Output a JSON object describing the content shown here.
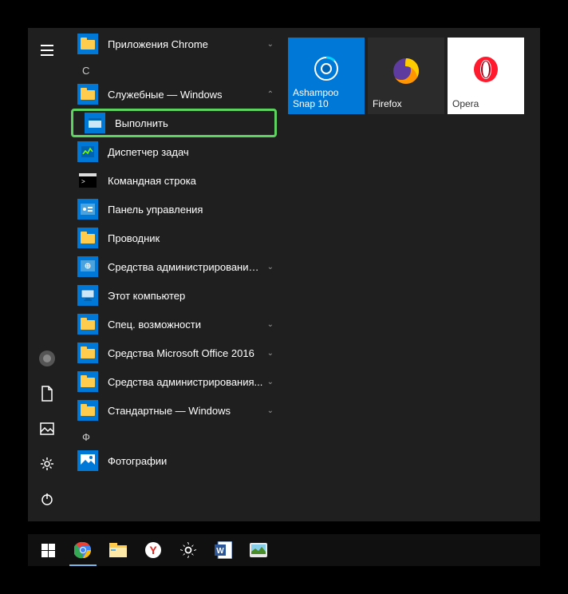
{
  "letters": {
    "c": "С",
    "f": "Ф"
  },
  "apps": {
    "chrome_apps": "Приложения Chrome",
    "system_windows": "Служебные — Windows",
    "run": "Выполнить",
    "task_manager": "Диспетчер задач",
    "cmd": "Командная строка",
    "control_panel": "Панель управления",
    "explorer": "Проводник",
    "admin_tools": "Средства администрирования Wi...",
    "this_pc": "Этот компьютер",
    "accessibility": "Спец. возможности",
    "office": "Средства Microsoft Office 2016",
    "admin_tools2": "Средства администрирования...",
    "standard": "Стандартные — Windows",
    "photos": "Фотографии"
  },
  "tiles": {
    "ashampoo": "Ashampoo Snap 10",
    "firefox": "Firefox",
    "opera": "Opera"
  },
  "colors": {
    "accent": "#0078d7",
    "highlight": "#5fd35f",
    "folder": "#ffcc4d"
  }
}
